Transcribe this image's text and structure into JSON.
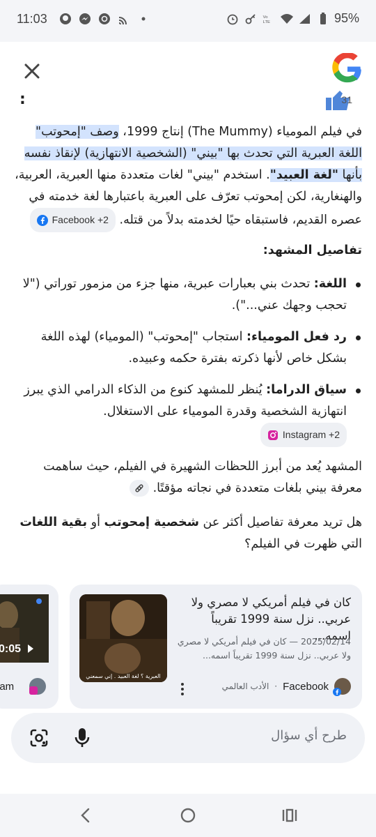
{
  "status_bar": {
    "time": "11:03",
    "battery": "95%",
    "left_icons": [
      "github-icon",
      "messenger-icon",
      "chatgpt-icon",
      "cast-icon",
      "dot-icon"
    ],
    "right_icons": [
      "alarm-icon",
      "key-icon",
      "volte-icon",
      "wifi-icon",
      "signal-icon",
      "battery-icon"
    ]
  },
  "header": {
    "close_icon": "close-icon",
    "logo": "google-logo"
  },
  "answer": {
    "intro_parts": {
      "a": "في فيلم المومياء (The Mummy) إنتاج 1999، ",
      "b": "وصف \"إمحوتب\" اللغة العبرية التي تحدث بها \"بيني\" (الشخصية الانتهازية) لإنقاذ نفسه بأنها ",
      "c": "\"لغة العبيد\"",
      "d": ". استخدم \"بيني\" لغات متعددة منها العبرية، العربية، والهنغارية، لكن إمحوتب تعرّف على العبرية باعتبارها لغة خدمته في عصره القديم، فاستبقاه حيًا لخدمته بدلاً من قتله."
    },
    "intro_source": "Facebook +2",
    "details_heading": "تفاصيل المشهد:",
    "bullets": [
      {
        "label": "اللغة:",
        "text": " تحدث بني بعبارات عبرية، منها جزء من مزمور توراتي (\"لا تحجب وجهك عني...\")."
      },
      {
        "label": "رد فعل المومياء:",
        "text": " استجاب \"إمحوتب\" (المومياء) لهذه اللغة بشكل خاص لأنها ذكرته بفترة حكمه وعبيده."
      },
      {
        "label": "سياق الدراما:",
        "text": " يُنظر للمشهد كنوع من الذكاء الدرامي الذي يبرز انتهازية الشخصية وقدرة المومياء على الاستغلال. ",
        "source": "Instagram +2"
      }
    ],
    "scene_paragraph": "المشهد يُعد من أبرز اللحظات الشهيرة في الفيلم، حيث ساهمت معرفة بيني بلغات متعددة في نجاته مؤقتًا.",
    "ask_parts": {
      "a": "هل تريد معرفة تفاصيل أكثر عن ",
      "b": "شخصية إمحوتب",
      "c": " أو ",
      "d": "بقية اللغات",
      "e": " التي ظهرت في الفيلم؟"
    }
  },
  "cards": {
    "main": {
      "title": "كان في فيلم أمريكي لا مصري ولا عربي.. نزل سنة 1999 تقريباً اسمه...",
      "snippet": "2025/02/14 — كان في فيلم أمريكي لا مصري ولا عربي.. نزل سنة 1999 تقريباً اسمه...",
      "source_name": "Facebook",
      "source_sub": "الأدب العالمي",
      "thumb_caption": "العبرية ؟ لغة العبيد . إني سمعني"
    },
    "side": {
      "time": "0:05",
      "label": "gram"
    }
  },
  "input": {
    "placeholder": "طرح أي سؤال"
  },
  "colors": {
    "highlight": "#d3e3fd",
    "chip_bg": "#eef0f4",
    "card_bg": "#eef0f5",
    "google_blue": "#4285f4",
    "google_red": "#ea4335",
    "google_yellow": "#fbbc05",
    "google_green": "#34a853"
  }
}
